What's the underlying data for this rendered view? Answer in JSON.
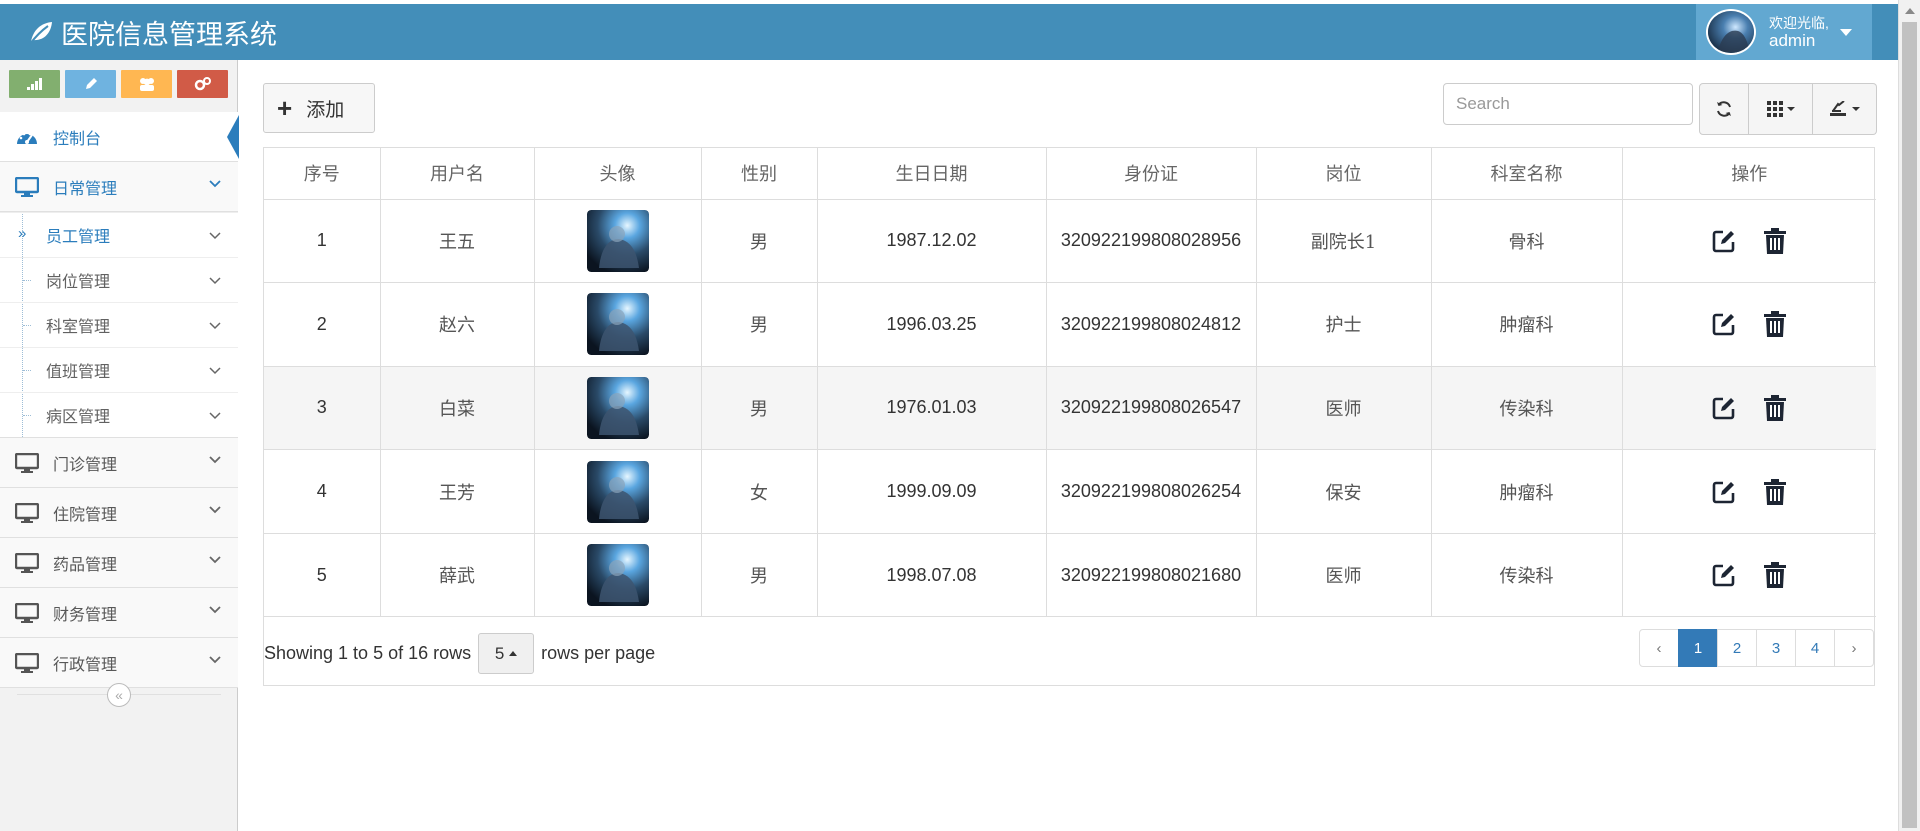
{
  "brand": {
    "title": "医院信息管理系统"
  },
  "user": {
    "welcome": "欢迎光临,",
    "name": "admin"
  },
  "sidebar": {
    "items": [
      {
        "label": "控制台"
      },
      {
        "label": "日常管理"
      },
      {
        "label": "门诊管理"
      },
      {
        "label": "住院管理"
      },
      {
        "label": "药品管理"
      },
      {
        "label": "财务管理"
      },
      {
        "label": "行政管理"
      }
    ],
    "sub_items": [
      {
        "label": "员工管理"
      },
      {
        "label": "岗位管理"
      },
      {
        "label": "科室管理"
      },
      {
        "label": "值班管理"
      },
      {
        "label": "病区管理"
      }
    ]
  },
  "toolbar": {
    "add_label": "添加",
    "search_placeholder": "Search"
  },
  "table": {
    "headers": [
      "序号",
      "用户名",
      "头像",
      "性别",
      "生日日期",
      "身份证",
      "岗位",
      "科室名称",
      "操作"
    ],
    "rows": [
      {
        "no": "1",
        "username": "王五",
        "gender": "男",
        "birthday": "1987.12.02",
        "id_card": "320922199808028956",
        "position": "副院长1",
        "department": "骨科"
      },
      {
        "no": "2",
        "username": "赵六",
        "gender": "男",
        "birthday": "1996.03.25",
        "id_card": "320922199808024812",
        "position": "护士",
        "department": "肿瘤科"
      },
      {
        "no": "3",
        "username": "白菜",
        "gender": "男",
        "birthday": "1976.01.03",
        "id_card": "320922199808026547",
        "position": "医师",
        "department": "传染科"
      },
      {
        "no": "4",
        "username": "王芳",
        "gender": "女",
        "birthday": "1999.09.09",
        "id_card": "320922199808026254",
        "position": "保安",
        "department": "肿瘤科"
      },
      {
        "no": "5",
        "username": "薛武",
        "gender": "男",
        "birthday": "1998.07.08",
        "id_card": "320922199808021680",
        "position": "医师",
        "department": "传染科"
      }
    ]
  },
  "pagination": {
    "showing": "Showing 1 to 5 of 16 rows",
    "page_size": "5",
    "per_page_label": "rows per page",
    "prev": "‹",
    "next": "›",
    "pages": [
      "1",
      "2",
      "3",
      "4"
    ],
    "active_page": "1"
  },
  "colors": {
    "navbar": "#438eb9",
    "accent": "#2b7dbc",
    "user_box": "#62a8d1",
    "pager_active": "#337ab7"
  }
}
